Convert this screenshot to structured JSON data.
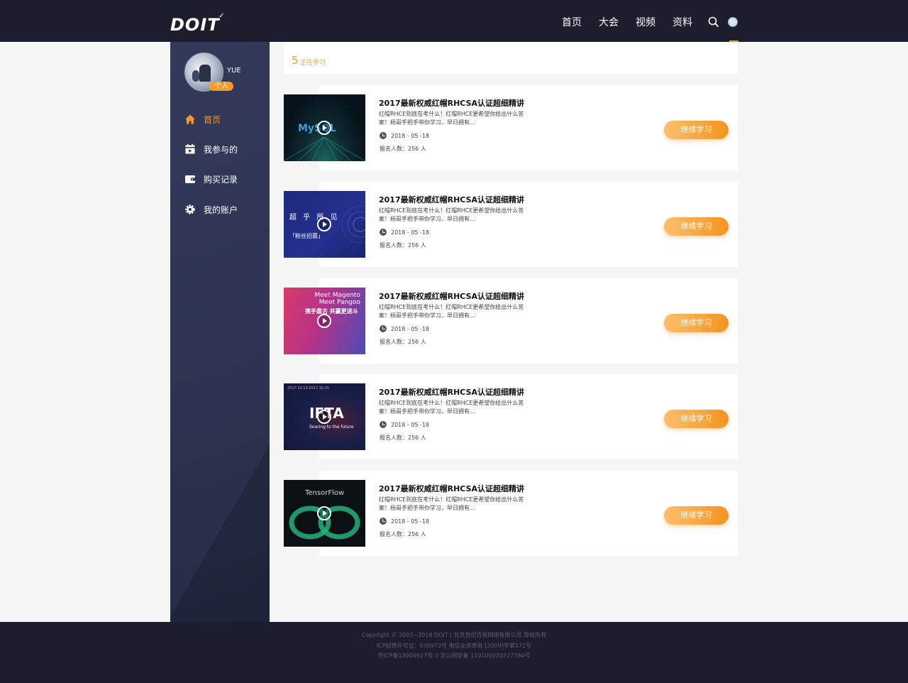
{
  "header": {
    "logo_text": "DOIT",
    "nav": [
      "首页",
      "大会",
      "视频",
      "资料"
    ],
    "icons": [
      "search-icon",
      "globe-icon"
    ],
    "accent_color": "#f59c28"
  },
  "sidebar": {
    "username": "YUE",
    "role_badge": "个人",
    "items": [
      {
        "label": "首页",
        "icon": "home-icon",
        "active": true
      },
      {
        "label": "我参与的",
        "icon": "calendar-icon",
        "active": false
      },
      {
        "label": "购买记录",
        "icon": "wallet-icon",
        "active": false
      },
      {
        "label": "我的账户",
        "icon": "gear-icon",
        "active": false
      }
    ]
  },
  "status": {
    "count": "5",
    "label": "正在学习"
  },
  "courses": [
    {
      "title": "2017最新权威红帽RHCSA认证超细精讲",
      "description": "红帽RHCE到底在考什么！红帽RHCE更希望你给出什么答案！杨哥手把手带你学习，早日拥有...",
      "date": "2018 - 05 -18",
      "enrolled": "报名人数：256 人",
      "button": "继续学习",
      "thumb_caption": "MySQL"
    },
    {
      "title": "2017最新权威红帽RHCSA认证超细精讲",
      "description": "红帽RHCE到底在考什么！红帽RHCE更希望你给出什么答案！杨哥手把手带你学习，早日拥有...",
      "date": "2018 - 05 -18",
      "enrolled": "报名人数：256 人",
      "button": "继续学习",
      "thumb_caption": "「粉丝招募」"
    },
    {
      "title": "2017最新权威红帽RHCSA认证超细精讲",
      "description": "红帽RHCE到底在考什么！红帽RHCE更希望你给出什么答案！杨哥手把手带你学习，早日拥有...",
      "date": "2018 - 05 -18",
      "enrolled": "报名人数：256 人",
      "button": "继续学习",
      "thumb_caption": "Meet Magento Meet Pangoo"
    },
    {
      "title": "2017最新权威红帽RHCSA认证超细精讲",
      "description": "红帽RHCE到底在考什么！红帽RHCE更希望你给出什么答案！杨哥手把手带你学习，早日拥有...",
      "date": "2018 - 05 -18",
      "enrolled": "报名人数：256 人",
      "button": "继续学习",
      "thumb_caption": "IFTA"
    },
    {
      "title": "2017最新权威红帽RHCSA认证超细精讲",
      "description": "红帽RHCE到底在考什么！红帽RHCE更希望你给出什么答案！杨哥手把手带你学习，早日拥有...",
      "date": "2018 - 05 -18",
      "enrolled": "报名人数：256 人",
      "button": "继续学习",
      "thumb_caption": "TensorFlow"
    }
  ],
  "footer": {
    "lines": [
      "Copyright © 2003~2018 DOIT | 北京世纪百易网络有限公司 版权所有",
      "ICP经营许可证：030972号 电信业务审批 [2009]字第572号",
      "京ICP备13004627号-3 京公网安备 110105020327764号"
    ]
  }
}
